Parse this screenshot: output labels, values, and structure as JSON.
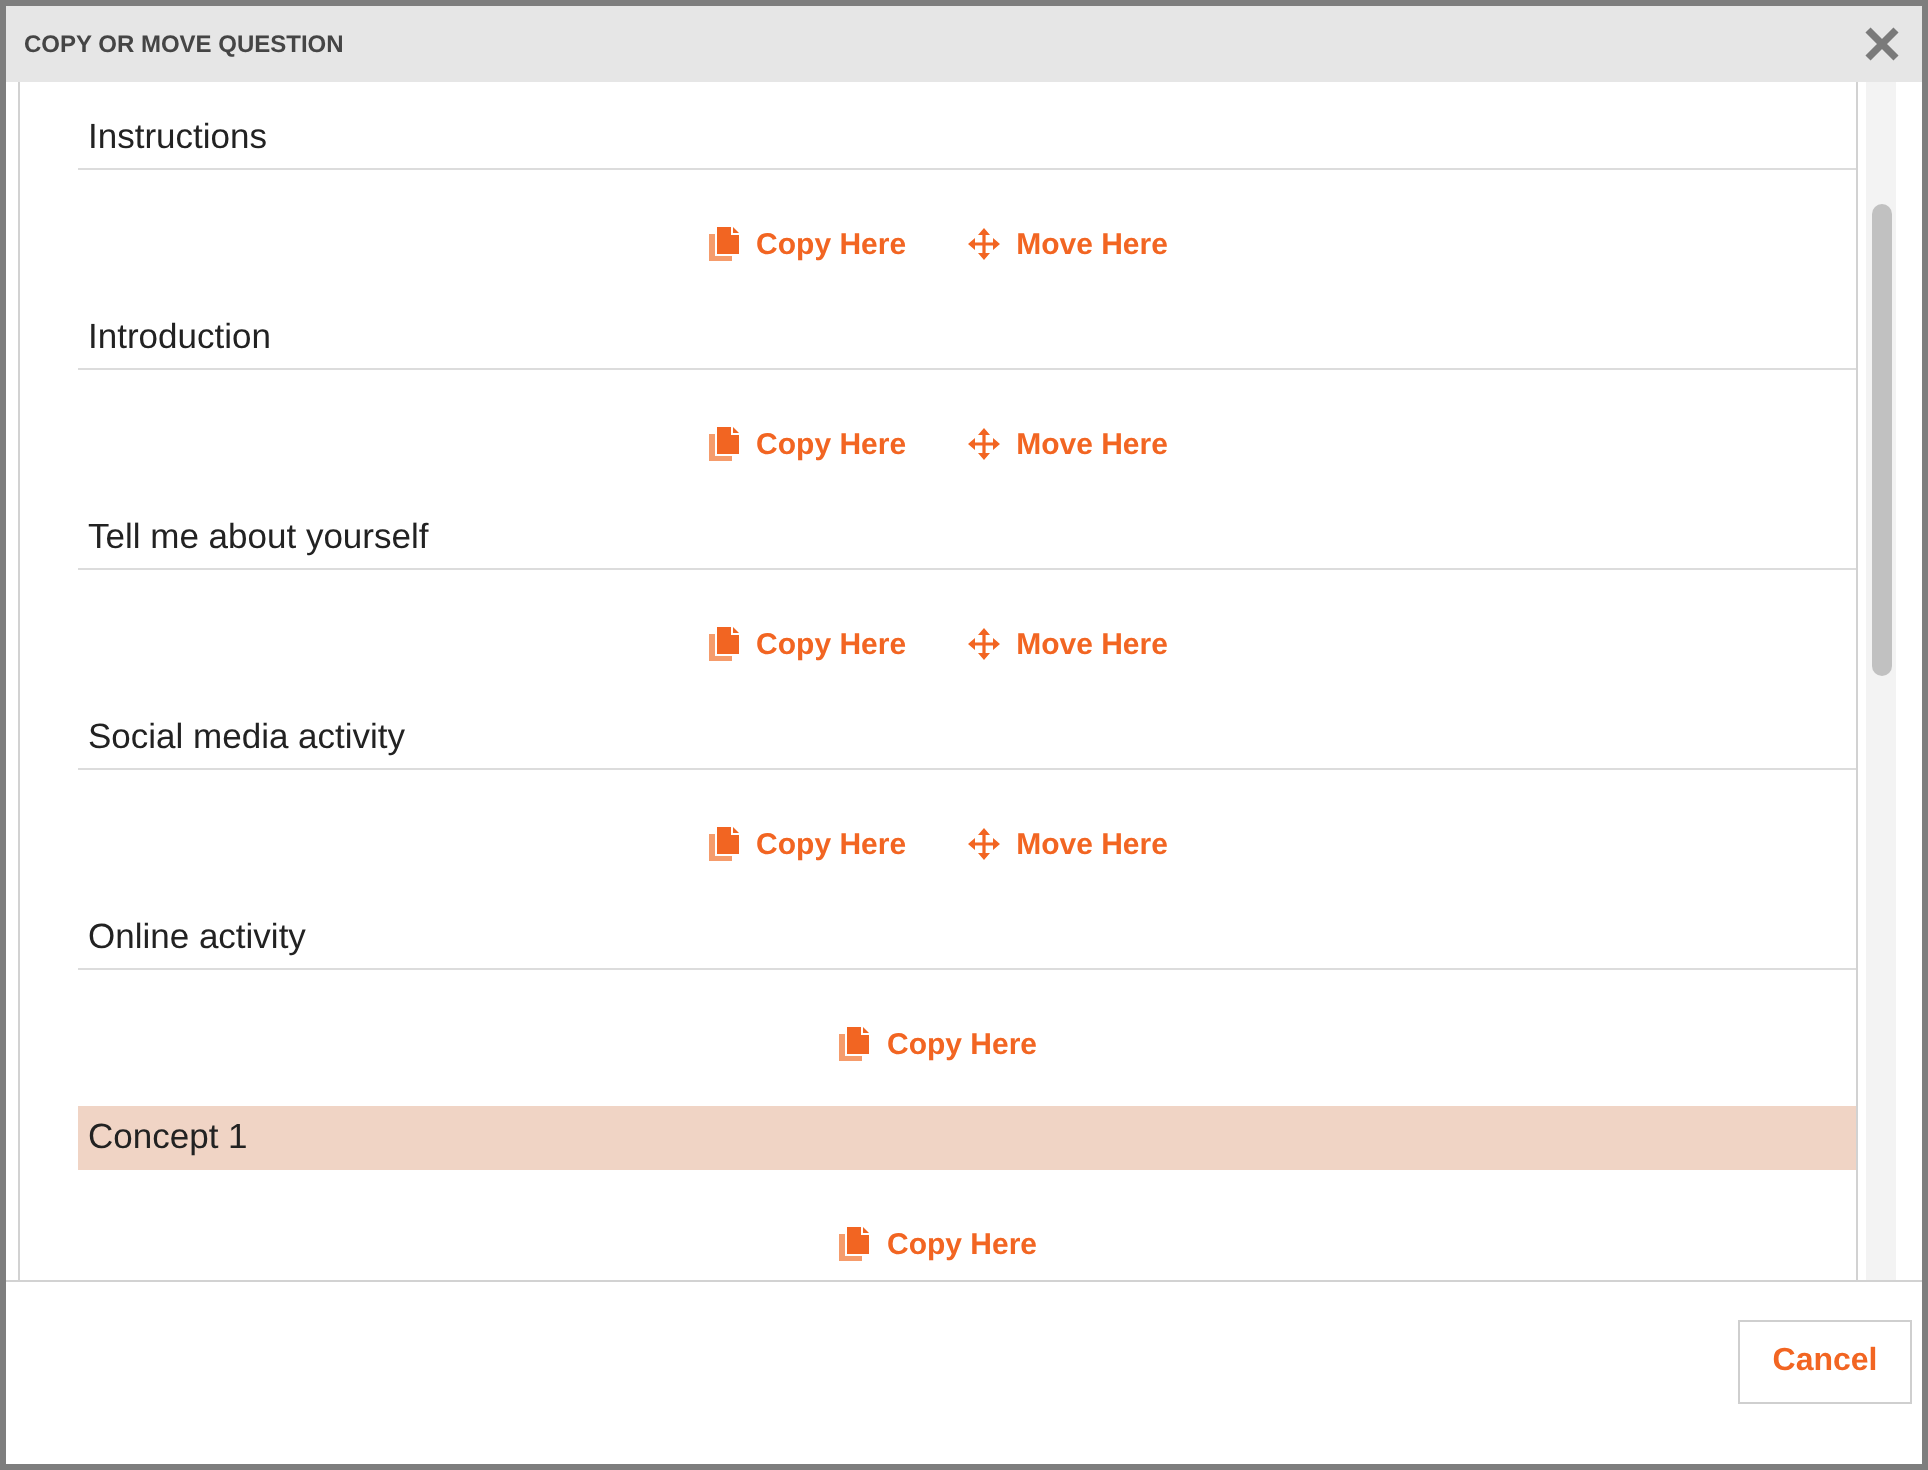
{
  "dialog": {
    "title": "COPY OR MOVE QUESTION"
  },
  "sections": [
    {
      "title": "Instructions",
      "selected": false,
      "actions": [
        {
          "kind": "copy",
          "label": "Copy Here"
        },
        {
          "kind": "move",
          "label": "Move Here"
        }
      ]
    },
    {
      "title": "Introduction",
      "selected": false,
      "actions": [
        {
          "kind": "copy",
          "label": "Copy Here"
        },
        {
          "kind": "move",
          "label": "Move Here"
        }
      ]
    },
    {
      "title": "Tell me about yourself",
      "selected": false,
      "actions": [
        {
          "kind": "copy",
          "label": "Copy Here"
        },
        {
          "kind": "move",
          "label": "Move Here"
        }
      ]
    },
    {
      "title": "Social media activity",
      "selected": false,
      "actions": [
        {
          "kind": "copy",
          "label": "Copy Here"
        },
        {
          "kind": "move",
          "label": "Move Here"
        }
      ]
    },
    {
      "title": "Online activity",
      "selected": false,
      "actions": [
        {
          "kind": "copy",
          "label": "Copy Here"
        }
      ]
    },
    {
      "title": "Concept 1",
      "selected": true,
      "actions": [
        {
          "kind": "copy",
          "label": "Copy Here"
        }
      ]
    }
  ],
  "footer": {
    "buttons": [
      "Cancel"
    ]
  }
}
